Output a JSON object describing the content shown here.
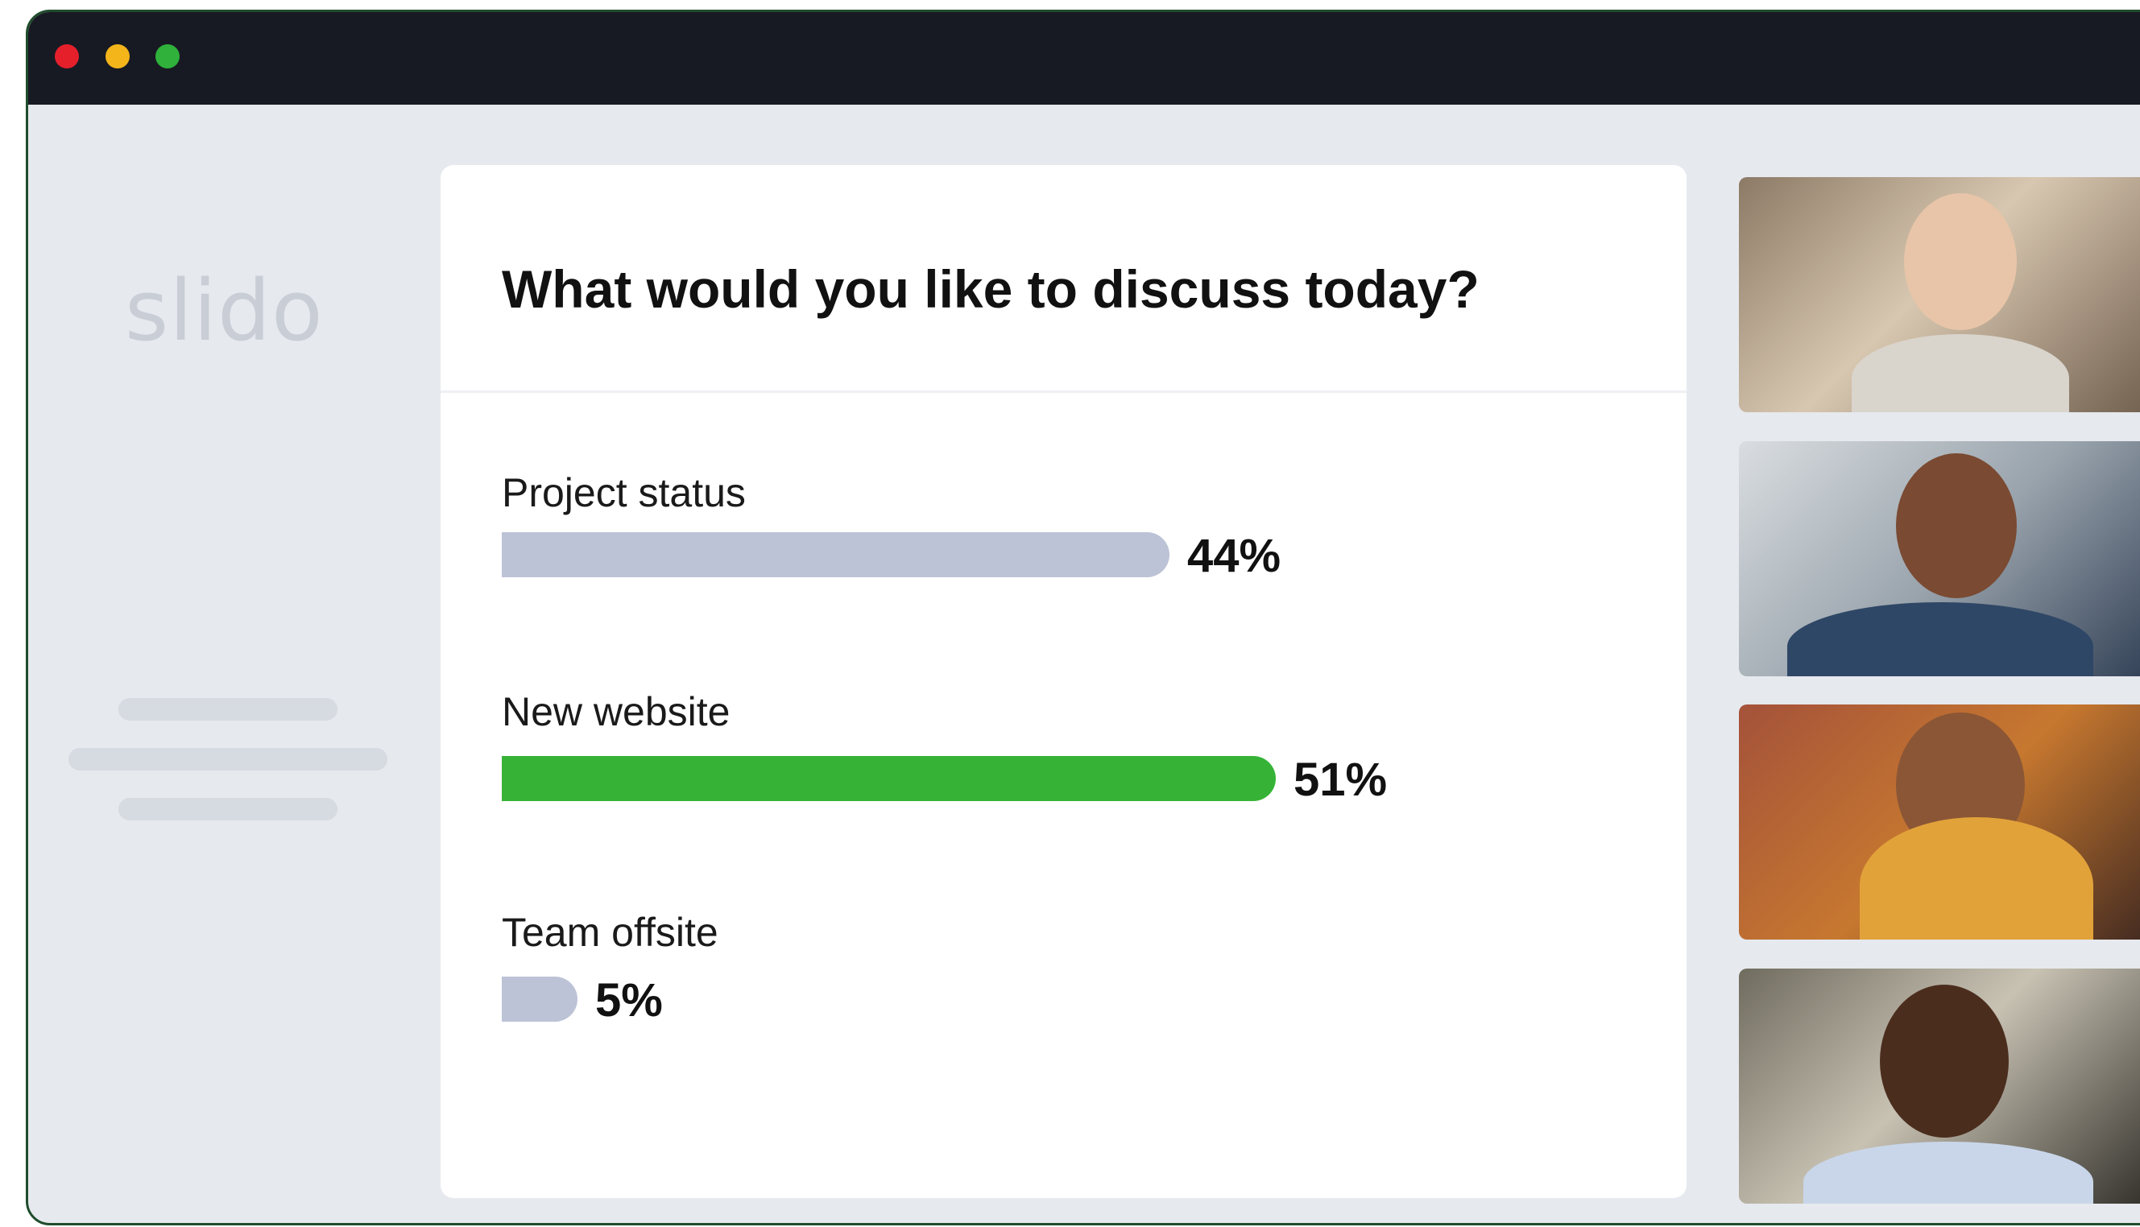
{
  "app": {
    "logo": "slido"
  },
  "poll": {
    "question": "What would you like to discuss today?",
    "options": [
      {
        "label": "Project status",
        "percent_label": "44%",
        "percent": 44,
        "color": "#bcc3d6"
      },
      {
        "label": "New website",
        "percent_label": "51%",
        "percent": 51,
        "color": "#36b336"
      },
      {
        "label": "Team offsite",
        "percent_label": "5%",
        "percent": 5,
        "color": "#bcc3d6"
      }
    ]
  },
  "video_tiles": [
    {
      "icon": "participant-video"
    },
    {
      "icon": "participant-video"
    },
    {
      "icon": "participant-video"
    },
    {
      "icon": "participant-video"
    }
  ],
  "colors": {
    "titlebar": "#181a23",
    "close": "#e5202b",
    "minimize": "#f4b51b",
    "maximize": "#2fb13b",
    "accent": "#36b336"
  }
}
